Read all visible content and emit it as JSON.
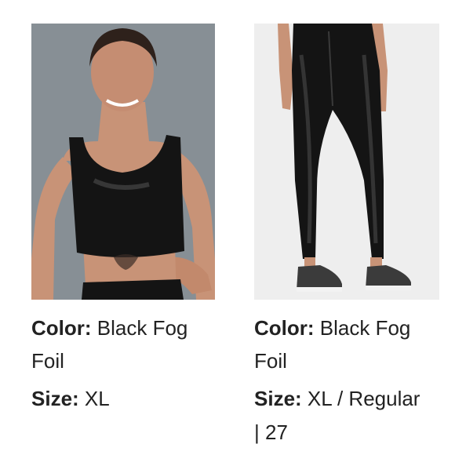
{
  "products": [
    {
      "image_alt": "woman in black crop top",
      "color_label": "Color:",
      "color_value_line1": " Black Fog",
      "color_value_line2": "Foil",
      "size_label": "Size:",
      "size_value": " XL"
    },
    {
      "image_alt": "black leggings with sneakers",
      "color_label": "Color:",
      "color_value_line1": " Black Fog",
      "color_value_line2": "Foil",
      "size_label": "Size:",
      "size_value_line1": " XL /  Regular",
      "size_value_line2": "| 27"
    }
  ],
  "colors": {
    "text": "#222222",
    "photo_bg_left": "#8e959b",
    "photo_bg_right": "#eeeeee",
    "garment": "#141414"
  }
}
